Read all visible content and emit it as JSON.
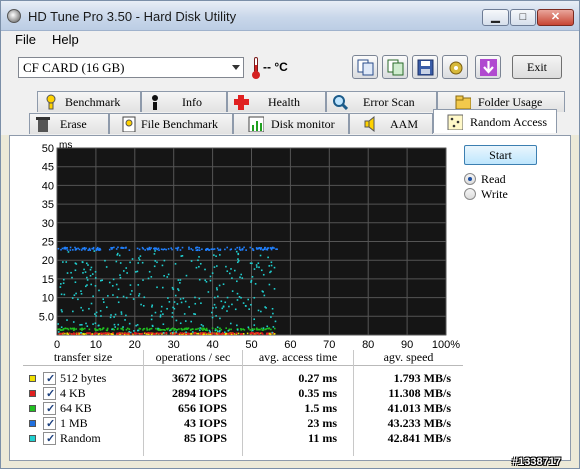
{
  "window": {
    "title": "HD Tune Pro 3.50 - Hard Disk Utility",
    "controls": {
      "minimize": "▁",
      "maximize": "□",
      "close": "✕"
    }
  },
  "menu": {
    "file": "File",
    "help": "Help"
  },
  "toolbar": {
    "drive": "CF CARD (16 GB)",
    "temperature": "-- °C",
    "exit_label": "Exit"
  },
  "tabs": {
    "row1": [
      "Benchmark",
      "Info",
      "Health",
      "Error Scan",
      "Folder Usage"
    ],
    "row2": [
      "Erase",
      "File Benchmark",
      "Disk monitor",
      "AAM",
      "Random Access"
    ],
    "active": "Random Access"
  },
  "controls": {
    "start_label": "Start",
    "read_label": "Read",
    "write_label": "Write",
    "selected": "Read"
  },
  "chart_data": {
    "type": "scatter",
    "title": "",
    "ylabel": "ms",
    "xlabel": "",
    "y_ticks": [
      "50",
      "45",
      "40",
      "35",
      "30",
      "25",
      "20",
      "15",
      "10",
      "5.0"
    ],
    "x_ticks": [
      "0",
      "10",
      "20",
      "30",
      "40",
      "50",
      "60",
      "70",
      "80",
      "90",
      "100%"
    ],
    "ylim": [
      0,
      50
    ],
    "xlim": [
      0,
      100
    ],
    "grid": true,
    "series": [
      {
        "name": "512 bytes",
        "color": "#f0e000",
        "y_level": 0.27,
        "spread": 0.15,
        "x_max": 56
      },
      {
        "name": "4 KB",
        "color": "#e02020",
        "y_level": 0.35,
        "spread": 0.2,
        "x_max": 56
      },
      {
        "name": "64 KB",
        "color": "#20c020",
        "y_level": 1.5,
        "spread": 0.3,
        "x_max": 56
      },
      {
        "name": "1 MB",
        "color": "#2080ff",
        "y_level": 23,
        "spread": 0.4,
        "x_max": 57
      },
      {
        "name": "Random",
        "color": "#20d0d0",
        "y_level": 11,
        "spread": 11,
        "x_max": 56
      }
    ]
  },
  "results": {
    "headers": {
      "transfer_size": "transfer size",
      "ops": "operations / sec",
      "access": "avg. access time",
      "speed": "agv. speed"
    },
    "rows": [
      {
        "size": "512 bytes",
        "color": "#f0e000",
        "iops": "3672 IOPS",
        "access": "0.27 ms",
        "speed": "1.793 MB/s"
      },
      {
        "size": "4 KB",
        "color": "#e02020",
        "iops": "2894 IOPS",
        "access": "0.35 ms",
        "speed": "11.308 MB/s"
      },
      {
        "size": "64 KB",
        "color": "#20c020",
        "iops": "656 IOPS",
        "access": "1.5 ms",
        "speed": "41.013 MB/s"
      },
      {
        "size": "1 MB",
        "color": "#2070e0",
        "iops": "43 IOPS",
        "access": "23 ms",
        "speed": "43.233 MB/s"
      },
      {
        "size": "Random",
        "color": "#20d0d0",
        "iops": "85 IOPS",
        "access": "11 ms",
        "speed": "42.841 MB/s"
      }
    ]
  },
  "watermark": "#1338717"
}
